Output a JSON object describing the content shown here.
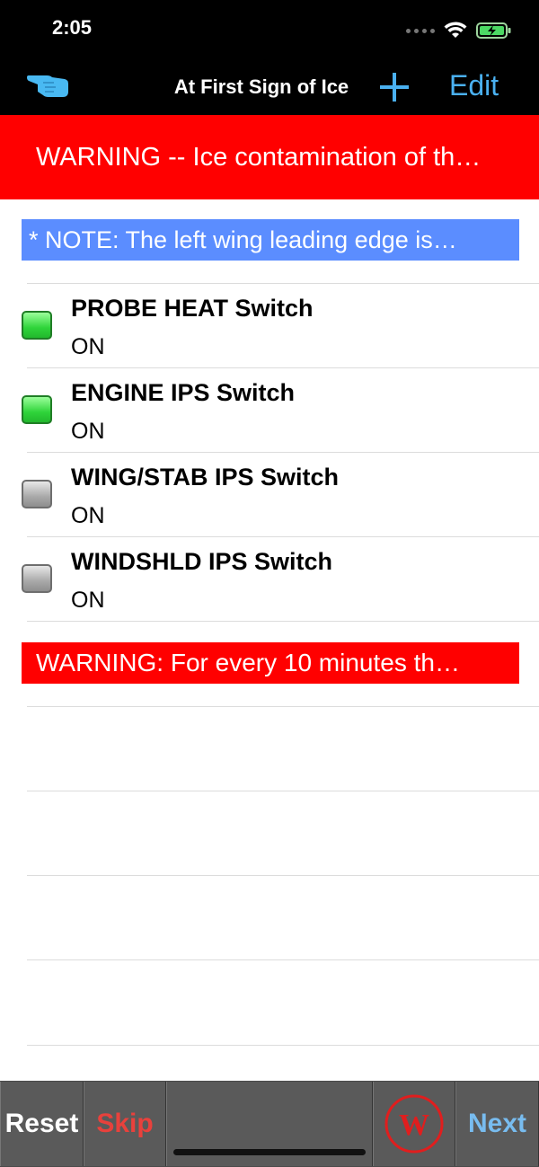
{
  "status_bar": {
    "time": "2:05"
  },
  "nav": {
    "title": "At First Sign of Ice",
    "edit_label": "Edit",
    "accent_color": "#4ab0f0"
  },
  "banner_warning": "WARNING --  Ice contamination of th…",
  "note": "* NOTE: The left wing leading edge is…",
  "items": [
    {
      "title": "PROBE HEAT Switch",
      "value": "ON",
      "checked": true
    },
    {
      "title": "ENGINE IPS Switch",
      "value": "ON",
      "checked": true
    },
    {
      "title": "WING/STAB IPS Switch",
      "value": "ON",
      "checked": false
    },
    {
      "title": "WINDSHLD IPS Switch",
      "value": "ON",
      "checked": false
    }
  ],
  "warning_footer": "WARNING:  For every 10 minutes th…",
  "toolbar": {
    "reset_label": "Reset",
    "skip_label": "Skip",
    "w_label": "W",
    "next_label": "Next"
  },
  "colors": {
    "warning_red": "#ff0000",
    "note_blue": "#5b8dff",
    "check_on": "#2fd43a",
    "check_off": "#a9a9a9"
  }
}
